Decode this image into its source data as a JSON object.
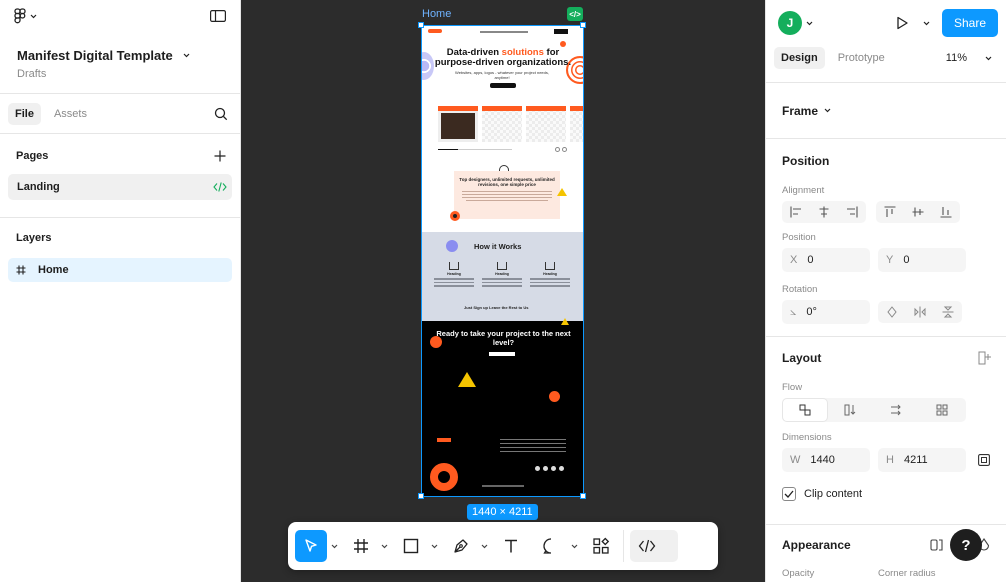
{
  "file": {
    "title": "Manifest Digital Template",
    "location": "Drafts"
  },
  "left_tabs": {
    "file": "File",
    "assets": "Assets"
  },
  "pages": {
    "heading": "Pages",
    "items": [
      {
        "label": "Landing"
      }
    ]
  },
  "layers": {
    "heading": "Layers",
    "items": [
      {
        "label": "Home"
      }
    ]
  },
  "canvas": {
    "frame_name": "Home",
    "frame_dims": "1440 × 4211",
    "preview": {
      "hero_title_1": "Data-driven ",
      "hero_title_accent": "solutions",
      "hero_title_2": " for purpose-driven organizations.",
      "hero_sub": "Websites, apps, logos - whatever your project needs, anytime!",
      "quote": "Top designers, unlimited requests, unlimited revisions, one simple price",
      "how_title": "How it Works",
      "how_cols": [
        "Heading",
        "Heading",
        "Heading"
      ],
      "how_cta": "Just Sign up Leave the Rest to Us",
      "dark_title": "Ready to take your project to the next level?"
    }
  },
  "header_right": {
    "avatar_initial": "J",
    "share_label": "Share"
  },
  "right_tabs": {
    "design": "Design",
    "prototype": "Prototype",
    "zoom": "11%"
  },
  "frame_section": {
    "label": "Frame"
  },
  "position_section": {
    "title": "Position",
    "alignment_label": "Alignment",
    "position_label": "Position",
    "x_key": "X",
    "x_value": "0",
    "y_key": "Y",
    "y_value": "0",
    "rotation_label": "Rotation",
    "rotation_value": "0°"
  },
  "layout_section": {
    "title": "Layout",
    "flow_label": "Flow",
    "dimensions_label": "Dimensions",
    "w_key": "W",
    "w_value": "1440",
    "h_key": "H",
    "h_value": "4211",
    "clip_label": "Clip content",
    "clip_checked": true
  },
  "appearance_section": {
    "title": "Appearance",
    "opacity_label": "Opacity",
    "radius_label": "Corner radius"
  },
  "help": "?",
  "colors": {
    "accent": "#0d99ff",
    "brand_orange": "#ff5a1f",
    "dev_green": "#14ae5c",
    "canvas_bg": "#2c2c2c"
  }
}
